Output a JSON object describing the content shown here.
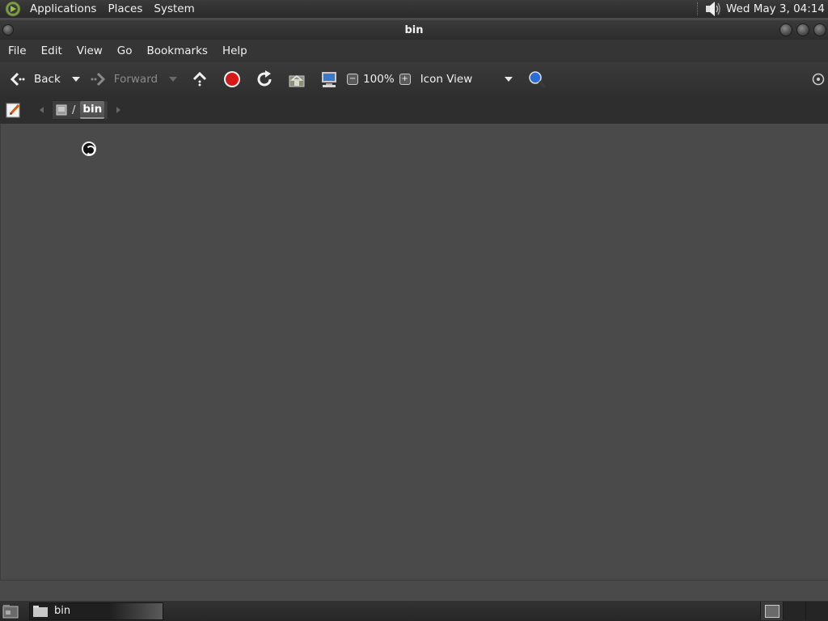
{
  "top_panel": {
    "menus": [
      "Applications",
      "Places",
      "System"
    ],
    "clock": "Wed May  3, 04:14"
  },
  "window": {
    "title": "bin"
  },
  "menubar": {
    "items": [
      "File",
      "Edit",
      "View",
      "Go",
      "Bookmarks",
      "Help"
    ]
  },
  "toolbar": {
    "back_label": "Back",
    "forward_label": "Forward",
    "zoom_level": "100%",
    "view_mode": "Icon View"
  },
  "location": {
    "separator": "/",
    "current": "bin"
  },
  "taskbar": {
    "tasks": [
      {
        "label": "bin"
      }
    ]
  },
  "colors": {
    "background": "#4a4a4a",
    "panel": "#2e2e2e",
    "stop_red": "#d81818",
    "search_blue": "#2a6dd8"
  }
}
